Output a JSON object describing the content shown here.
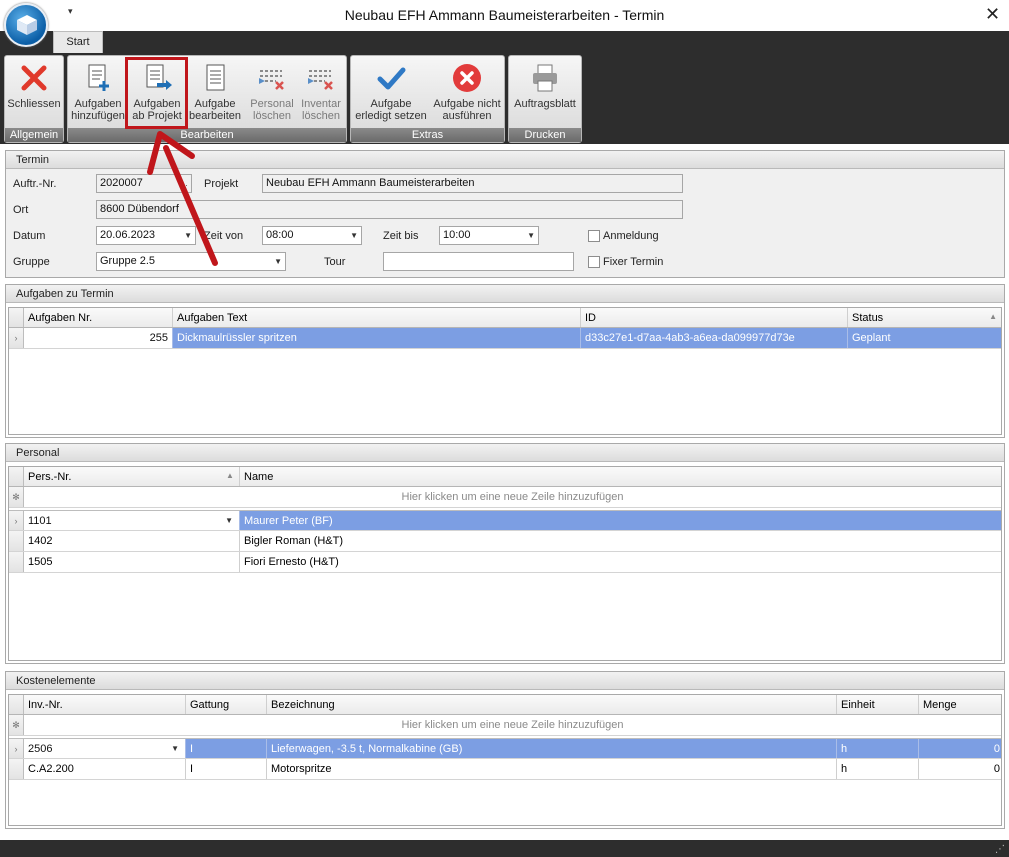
{
  "window": {
    "title": "Neubau EFH Ammann Baumeisterarbeiten - Termin",
    "close": "✕",
    "qat": "▾"
  },
  "tabs": {
    "start": "Start"
  },
  "ribbon": {
    "groups": {
      "allgemein": "Allgemein",
      "bearbeiten": "Bearbeiten",
      "extras": "Extras",
      "drucken": "Drucken"
    },
    "buttons": {
      "schliessen": [
        "Schliessen",
        ""
      ],
      "aufgaben_hinzufuegen": [
        "Aufgaben",
        "hinzufügen"
      ],
      "aufgaben_ab_projekt": [
        "Aufgaben",
        "ab Projekt"
      ],
      "aufgabe_bearbeiten": [
        "Aufgabe",
        "bearbeiten"
      ],
      "personal_loeschen": [
        "Personal",
        "löschen"
      ],
      "inventar_loeschen": [
        "Inventar",
        "löschen"
      ],
      "erledigt": [
        "Aufgabe",
        "erledigt setzen"
      ],
      "nicht_ausfuehren": [
        "Aufgabe nicht",
        "ausführen"
      ],
      "auftragsblatt": [
        "Auftragsblatt",
        ""
      ]
    }
  },
  "termin": {
    "header": "Termin",
    "auftr_label": "Auftr.-Nr.",
    "auftr_value": "2020007",
    "projekt_label": "Projekt",
    "projekt_value": "Neubau EFH Ammann Baumeisterarbeiten",
    "ort_label": "Ort",
    "ort_value": "8600 Dübendorf",
    "datum_label": "Datum",
    "datum_value": "20.06.2023",
    "zeit_von_label": "Zeit von",
    "zeit_von_value": "08:00",
    "zeit_bis_label": "Zeit bis",
    "zeit_bis_value": "10:00",
    "anmeldung_label": "Anmeldung",
    "gruppe_label": "Gruppe",
    "gruppe_value": "Gruppe 2.5",
    "tour_label": "Tour",
    "tour_value": "",
    "fixer_termin_label": "Fixer Termin"
  },
  "aufgaben": {
    "header": "Aufgaben zu Termin",
    "columns": [
      "Aufgaben Nr.",
      "Aufgaben Text",
      "ID",
      "Status"
    ],
    "rows": [
      [
        "255",
        "Dickmaulrüssler spritzen",
        "d33c27e1-d7aa-4ab3-a6ea-da099977d73e",
        "Geplant"
      ]
    ]
  },
  "personal": {
    "header": "Personal",
    "columns": [
      "Pers.-Nr.",
      "Name"
    ],
    "new_row_hint": "Hier klicken um eine neue Zeile hinzuzufügen",
    "rows": [
      [
        "1101",
        "Maurer Peter (BF)"
      ],
      [
        "1402",
        "Bigler Roman (H&T)"
      ],
      [
        "1505",
        "Fiori Ernesto (H&T)"
      ]
    ]
  },
  "kosten": {
    "header": "Kostenelemente",
    "columns": [
      "Inv.-Nr.",
      "Gattung",
      "Bezeichnung",
      "Einheit",
      "Menge"
    ],
    "new_row_hint": "Hier klicken um eine neue Zeile hinzuzufügen",
    "rows": [
      [
        "2506",
        "I",
        "Lieferwagen, -3.5 t, Normalkabine (GB)",
        "h",
        "0"
      ],
      [
        "C.A2.200",
        "I",
        "Motorspritze",
        "h",
        "0"
      ]
    ]
  }
}
